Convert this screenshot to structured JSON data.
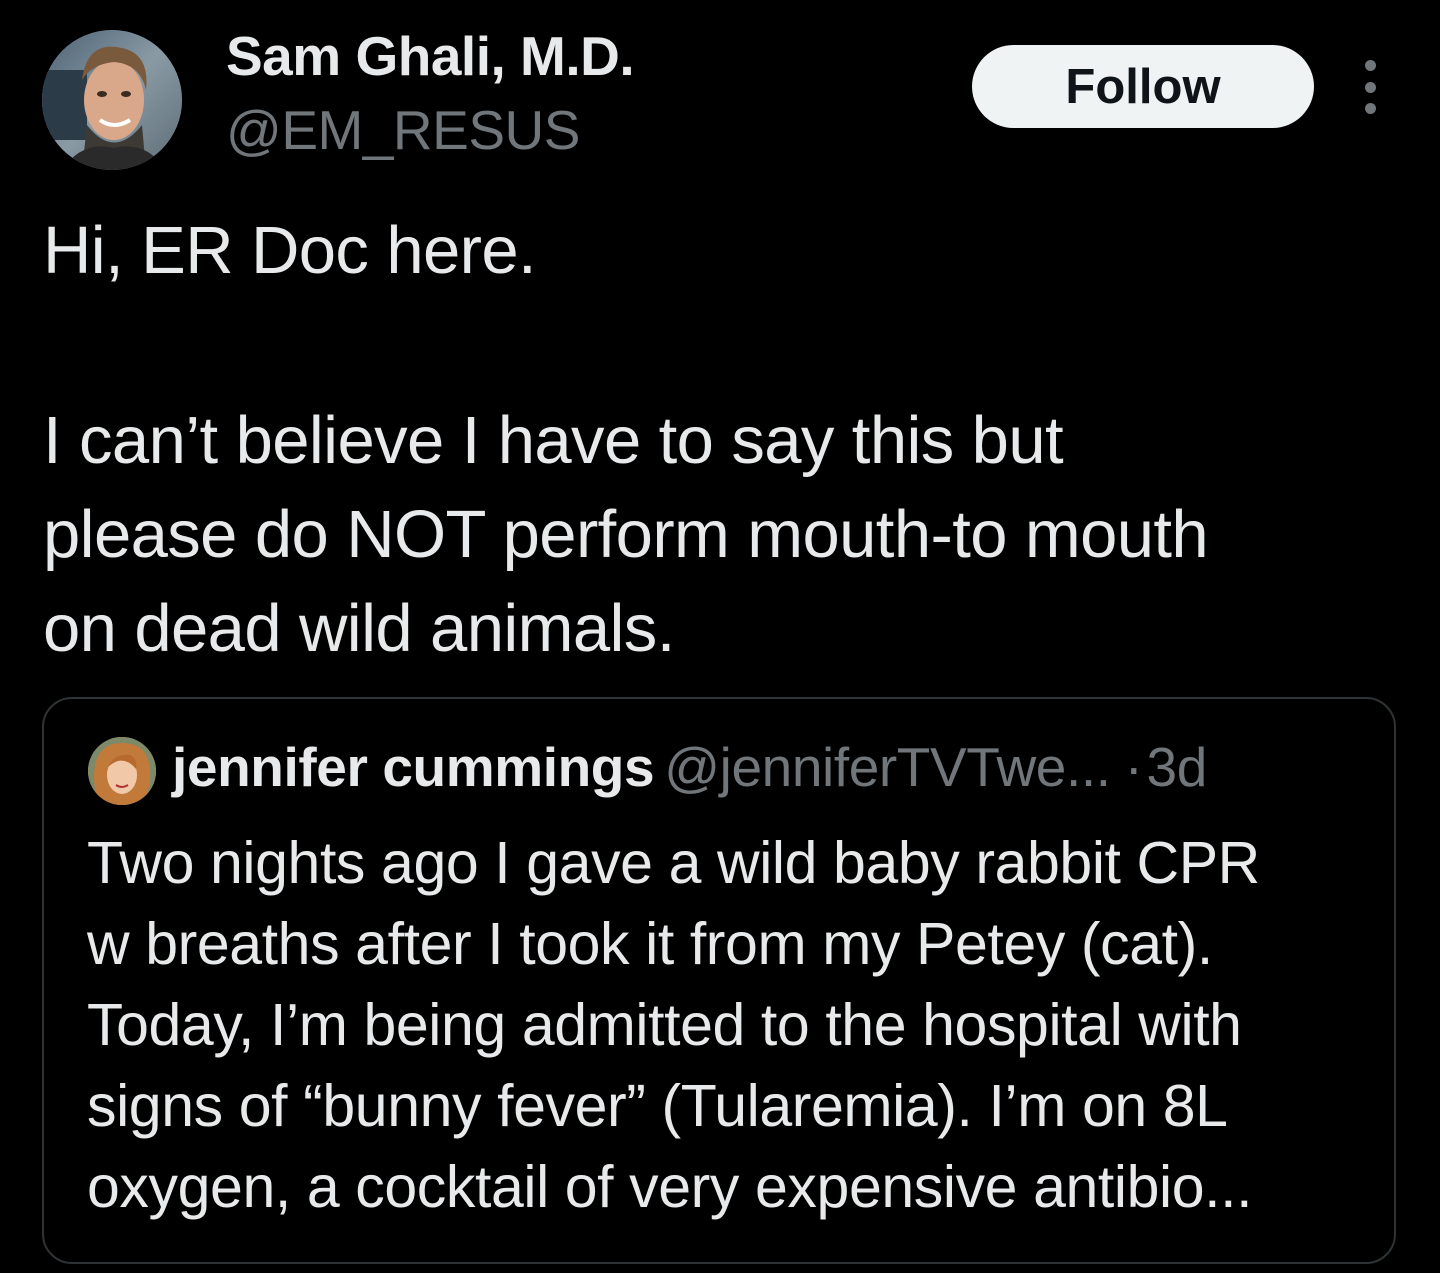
{
  "author": {
    "name": "Sam Ghali, M.D.",
    "handle": "@EM_RESUS",
    "avatar_icon": "profile-photo"
  },
  "actions": {
    "follow_label": "Follow",
    "more_icon": "more-options-icon"
  },
  "tweet": {
    "lines": [
      "Hi, ER Doc here.",
      "I can’t believe I have to say this but",
      "please do NOT perform mouth-to mouth",
      "on dead wild animals."
    ]
  },
  "quote": {
    "name": "jennifer cummings",
    "handle": "@jenniferTVTwe...",
    "separator": "·",
    "time": "3d",
    "lines": [
      "Two nights ago I gave a wild baby rabbit CPR",
      "w breaths after I took it from my Petey (cat).",
      "Today, I’m being admitted to the hospital with",
      "signs of “bunny fever” (Tularemia). I’m on 8L",
      "oxygen, a cocktail of very expensive antibio..."
    ]
  },
  "colors": {
    "background": "#000000",
    "primary_text": "#e7e9ea",
    "secondary_text": "#71767b",
    "border": "#2f3336",
    "button_bg": "#eff3f4"
  }
}
